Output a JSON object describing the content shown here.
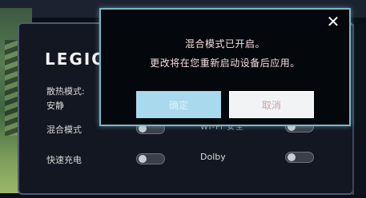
{
  "background": {
    "brand": "LEGIO",
    "thermal_mode_label": "散热模式:",
    "thermal_mode_value": "安静",
    "hybrid_mode_label": "混合模式",
    "fast_charge_label": "快速充电",
    "wifi_label_partial": "Wi-Fi 安全",
    "dolby_label": "Dolby"
  },
  "dialog": {
    "line1": "混合模式已开启。",
    "line2": "更改将在您重新启动设备后应用。",
    "confirm_label": "确定",
    "cancel_label": "取消",
    "close_glyph": "✕"
  },
  "colors": {
    "dialog_border": "#7fb6c8",
    "confirm_bg": "#a9d9ec",
    "cancel_bg": "#f2f3f5"
  }
}
